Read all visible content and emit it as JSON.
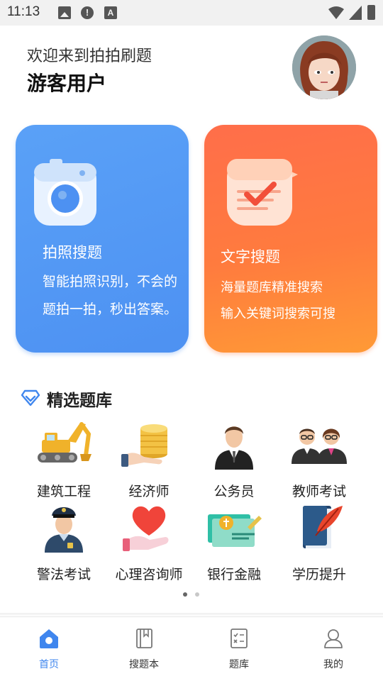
{
  "status_bar": {
    "time": "11:13",
    "alert_glyph": "!",
    "a_glyph": "A"
  },
  "header": {
    "welcome": "欢迎来到拍拍刷题",
    "username": "游客用户"
  },
  "cards": [
    {
      "title": "拍照搜题",
      "description": "智能拍照识别，不会的题拍一拍，秒出答案。",
      "icon": "camera-icon",
      "color": "#4d91f2"
    },
    {
      "title": "文字搜题",
      "line1": "海量题库精准搜索",
      "line2": "输入关键词搜索可搜",
      "icon": "checked-note-icon",
      "color": "#ff7a3e"
    }
  ],
  "section": {
    "title": "精选题库",
    "icon": "diamond-icon",
    "accent": "#3f86ee"
  },
  "categories": [
    {
      "label": "建筑工程",
      "icon": "excavator-icon"
    },
    {
      "label": "经济师",
      "icon": "coins-hand-icon"
    },
    {
      "label": "公务员",
      "icon": "businessman-icon"
    },
    {
      "label": "教师考试",
      "icon": "teachers-icon"
    },
    {
      "label": "警法考试",
      "icon": "police-icon"
    },
    {
      "label": "心理咨询师",
      "icon": "heart-hand-icon"
    },
    {
      "label": "银行金融",
      "icon": "bank-card-icon"
    },
    {
      "label": "学历提升",
      "icon": "book-quill-icon"
    }
  ],
  "pager": {
    "total": 2,
    "active": 1
  },
  "bottom_nav": [
    {
      "label": "首页",
      "icon": "home-icon",
      "active": true
    },
    {
      "label": "搜题本",
      "icon": "notebook-icon",
      "active": false
    },
    {
      "label": "题库",
      "icon": "question-bank-icon",
      "active": false
    },
    {
      "label": "我的",
      "icon": "profile-icon",
      "active": false
    }
  ]
}
